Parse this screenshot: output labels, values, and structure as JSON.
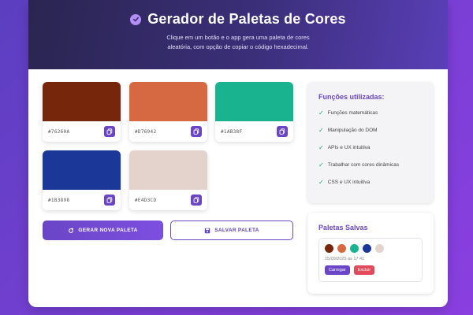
{
  "header": {
    "title": "Gerador de Paletas de Cores",
    "subtitle_line1": "Clique em um botão e o app gera uma paleta de cores",
    "subtitle_line2": "aleatória, com opção de copiar o código hexadecimal.",
    "icon": "check-circle-icon"
  },
  "palette": [
    {
      "hex": "#76260A",
      "color": "#76260A"
    },
    {
      "hex": "#D76942",
      "color": "#D76942"
    },
    {
      "hex": "#1AB38F",
      "color": "#1AB38F"
    },
    {
      "hex": "#1B3898",
      "color": "#1B3898"
    },
    {
      "hex": "#E4D3CD",
      "color": "#E4D3CD"
    }
  ],
  "actions": {
    "generate_label": "GERAR NOVA PALETA",
    "save_label": "SALVAR PALETA"
  },
  "functions": {
    "title": "Funções utilizadas:",
    "items": [
      "Funções matemáticas",
      "Manipulação do DOM",
      "APIs e UX intuitiva",
      "Trabalhar com cores dinâmicas",
      "CSS e UX intuitiva"
    ]
  },
  "saved": {
    "title": "Paletas Salvas",
    "entries": [
      {
        "colors": [
          "#76260A",
          "#D76942",
          "#1AB38F",
          "#1B3898",
          "#E4D3CD"
        ],
        "date": "15/09/2025 às 17:41",
        "load_label": "Carregar",
        "delete_label": "Excluir"
      }
    ]
  },
  "colors": {
    "accent": "#6a45c6",
    "danger": "#e04a5a",
    "check": "#19a37a"
  }
}
